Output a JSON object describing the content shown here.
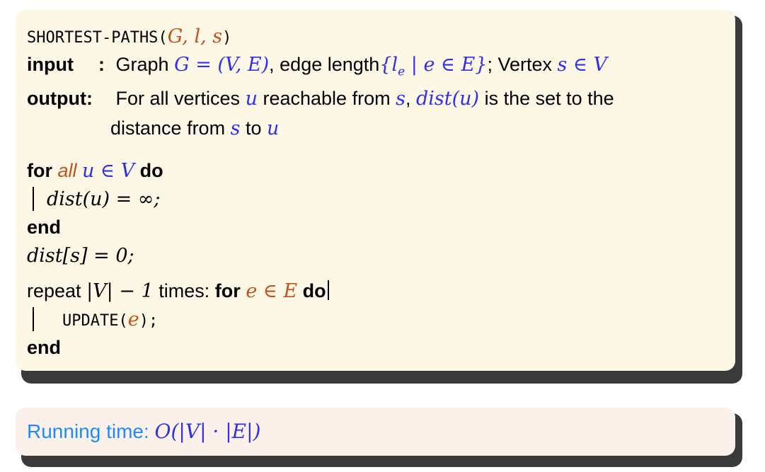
{
  "algorithm": {
    "proc_name": "SHORTEST-PATHS",
    "proc_args": "G, l, s",
    "input_label": "input",
    "input_text_1": "Graph",
    "input_expr_1": "G = (V, E)",
    "input_text_2": ", edge length",
    "input_expr_2": "{l",
    "input_expr_2_sub": "e",
    "input_expr_2b": " | e ∈ E}",
    "input_text_3": "; Vertex",
    "input_expr_3": "s ∈ V",
    "output_label": "output",
    "output_text_1": "For all vertices",
    "output_var_u": "u",
    "output_text_2": "reachable from",
    "output_var_s": "s",
    "output_text_3": ",",
    "output_dist": "dist(u)",
    "output_text_4": "is the set to the",
    "output_line2_text": "distance from",
    "output_line2_s": "s",
    "output_line2_to": "to",
    "output_line2_u": "u",
    "for_kw": "for",
    "for_all": "all",
    "for_expr": "u ∈ V",
    "do_kw": "do",
    "loop_body": "dist(u) = ∞;",
    "end_kw": "end",
    "init_stmt": "dist[s] = 0;",
    "repeat_text": "repeat",
    "repeat_expr": "|V| − 1",
    "repeat_times": "times:",
    "repeat_for": "for",
    "repeat_for_expr": "e ∈ E",
    "repeat_do": "do",
    "update_name": "UPDATE",
    "update_arg": "e",
    "end2_kw": "end"
  },
  "running_time": {
    "label": "Running time:",
    "expr": "O(|V| · |E|)"
  },
  "colors": {
    "math_blue": "#2f2ff0",
    "orange": "#c0541c",
    "running_time_label": "#1a8cff",
    "algo_box_bg": "#fdf7e6",
    "rt_box_bg": "#fcf1ea",
    "shadow": "#3a3a3a"
  }
}
